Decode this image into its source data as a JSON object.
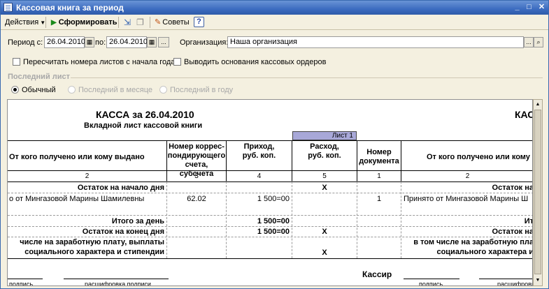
{
  "window": {
    "title": "Кассовая книга за период",
    "min": "_",
    "max": "□",
    "close": "✕"
  },
  "toolbar": {
    "actions": "Действия",
    "generate": "Сформировать",
    "tips": "Советы",
    "help": "?"
  },
  "form": {
    "period_from_label": "Период с:",
    "period_from": "26.04.2010",
    "period_to_label": "по:",
    "period_to": "26.04.2010",
    "dots": "...",
    "org_label": "Организация:",
    "org": "Наша организация",
    "renumber_label": "Пересчитать номера листов с начала года",
    "renumber_checked": false,
    "show_basis_label": "Выводить основания кассовых ордеров",
    "show_basis_checked": false,
    "last_sheet_label": "Последний лист",
    "radio_normal": "Обычный",
    "radio_last_month": "Последний в месяце",
    "radio_last_year": "Последний в году"
  },
  "report": {
    "title": "КАССА за 26.04.2010",
    "title_right": "КАС",
    "subtitle": "Вкладной лист кассовой книги",
    "sheet": "Лист 1",
    "headers": {
      "from_to": "От кого получено или кому выдано",
      "account": "Номер коррес-\nпондирующего\nсчета, субсчета",
      "income": "Приход,\nруб. коп.",
      "expense": "Расход,\nруб. коп.",
      "doc_number": "Номер\nдокумента",
      "from_to_right": "От кого получено или кому вы"
    },
    "col_numbers": [
      "2",
      "3",
      "4",
      "5",
      "1",
      "2"
    ],
    "rows": {
      "opening": "Остаток на начало дня",
      "opening_expense": "X",
      "opening_right": "Остаток на",
      "entry_name": "о от Мингазовой Марины Шамилевны",
      "entry_account": "62.02",
      "entry_income": "1 500=00",
      "entry_doc": "1",
      "entry_right": "Принято от Мингазовой Марины Ш",
      "day_total": "Итого за день",
      "day_total_income": "1 500=00",
      "day_total_right": "Ит",
      "closing": "Остаток на конец  дня",
      "closing_income": "1 500=00",
      "closing_expense": "X",
      "closing_right": "Остаток на",
      "salary_line1": "числе на заработную плату, выплаты",
      "salary_line2": "социального характера и стипендии",
      "salary_expense": "X",
      "salary_right1": "в том числе на заработную пла",
      "salary_right2": "социального характера и"
    },
    "cashier": "Кассир",
    "sign_left1": "подпись",
    "sign_left2": "расшифровка подписи",
    "sign_right1": "подпись",
    "sign_right2": "расшифровка"
  }
}
